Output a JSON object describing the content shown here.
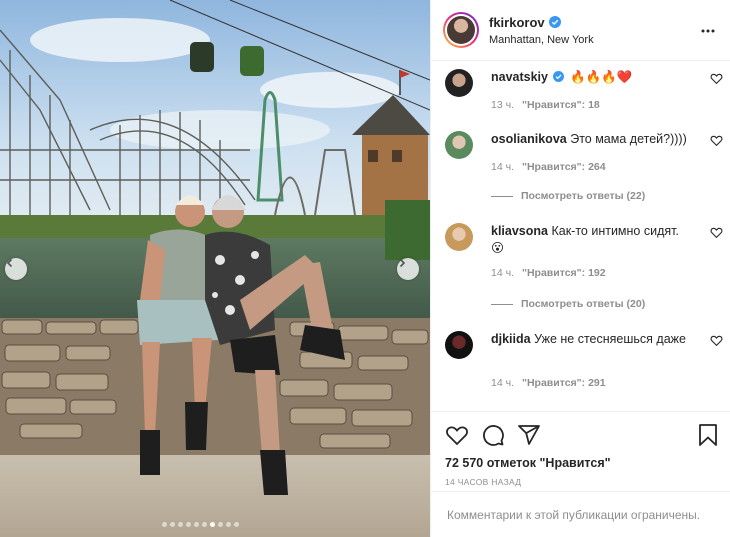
{
  "post": {
    "username": "fkirkorov",
    "location": "Manhattan, New York",
    "verified_icon": "verified-badge-icon"
  },
  "comments": [
    {
      "username": "navatskiy",
      "text": "🔥🔥🔥❤️",
      "time": "13 ч.",
      "likes": "\"Нравится\": 18",
      "verified": true
    },
    {
      "username": "osolianikova",
      "text": "Это мама детей?))))",
      "time": "14 ч.",
      "likes": "\"Нравится\": 264",
      "replies": "Посмотреть ответы (22)"
    },
    {
      "username": "kliavsona",
      "text": "Как-то интимно сидят. 😮",
      "time": "14 ч.",
      "likes": "\"Нравится\": 192",
      "replies": "Посмотреть ответы (20)"
    },
    {
      "username": "djkiida",
      "text": "Уже не стесняешься даже",
      "time": "14 ч.",
      "likes": "\"Нравится\": 291"
    }
  ],
  "stats": {
    "likes_text": "72 570 отметок \"Нравится\"",
    "time_ago": "14 ЧАСОВ НАЗАД"
  },
  "footer": {
    "restricted_text": "Комментарии к этой публикации ограничены."
  },
  "carousel": {
    "total_slides": 10,
    "active_slide": 7
  },
  "colors": {
    "verified": "#3897f0",
    "muted": "#8e8e8e",
    "text": "#262626",
    "border": "#efefef"
  }
}
